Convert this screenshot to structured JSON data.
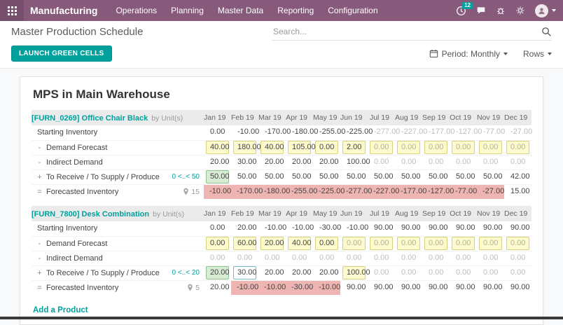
{
  "topbar": {
    "app": "Manufacturing",
    "menus": [
      "Operations",
      "Planning",
      "Master Data",
      "Reporting",
      "Configuration"
    ],
    "activity_count": "12"
  },
  "breadcrumb": {
    "title": "Master Production Schedule"
  },
  "search": {
    "placeholder": "Search..."
  },
  "controls": {
    "launch": "LAUNCH GREEN CELLS",
    "period": "Period: Monthly",
    "rows": "Rows"
  },
  "colors": {
    "brand": "#875A7B",
    "accent": "#00A09D",
    "cell_yellow": "#FDFACD",
    "cell_green": "#D8EBD3",
    "cell_red": "#EFB5B2"
  },
  "page": {
    "title": "MPS in Main Warehouse",
    "add_product": "Add a Product",
    "months": [
      "Jan 19",
      "Feb 19",
      "Mar 19",
      "Apr 19",
      "May 19",
      "Jun 19",
      "Jul 19",
      "Aug 19",
      "Sep 19",
      "Oct 19",
      "Nov 19",
      "Dec 19"
    ],
    "labels": {
      "starting": "Starting Inventory",
      "demand": "Demand Forecast",
      "indirect": "Indirect Demand",
      "supply": "To Receive / To Supply / Produce",
      "forecast": "Forecasted Inventory",
      "minus": "-",
      "plus": "+",
      "equals": "="
    },
    "products": [
      {
        "code": "[FURN_0269]",
        "name": "Office Chair Black",
        "by": "by",
        "uom": "Unit(s)",
        "supply_range": "0 <..< 50",
        "forecast_count": "15",
        "rows": {
          "starting": [
            {
              "v": "0.00",
              "k": "txt"
            },
            {
              "v": "-10.00",
              "k": "txt"
            },
            {
              "v": "-170.00",
              "k": "txt"
            },
            {
              "v": "-180.00",
              "k": "txt"
            },
            {
              "v": "-255.00",
              "k": "txt"
            },
            {
              "v": "-225.00",
              "k": "txt"
            },
            {
              "v": "-277.00",
              "k": "mut"
            },
            {
              "v": "-227.00",
              "k": "mut"
            },
            {
              "v": "-177.00",
              "k": "mut"
            },
            {
              "v": "-127.00",
              "k": "mut"
            },
            {
              "v": "-77.00",
              "k": "mut"
            },
            {
              "v": "-27.00",
              "k": "mut"
            }
          ],
          "demand": [
            {
              "v": "40.00",
              "k": "inp"
            },
            {
              "v": "180.00",
              "k": "inp"
            },
            {
              "v": "40.00",
              "k": "inp"
            },
            {
              "v": "105.00",
              "k": "inp"
            },
            {
              "v": "0.00",
              "k": "inp"
            },
            {
              "v": "2.00",
              "k": "inp"
            },
            {
              "v": "0.00",
              "k": "inpmut"
            },
            {
              "v": "0.00",
              "k": "inpmut"
            },
            {
              "v": "0.00",
              "k": "inpmut"
            },
            {
              "v": "0.00",
              "k": "inpmut"
            },
            {
              "v": "0.00",
              "k": "inpmut"
            },
            {
              "v": "0.00",
              "k": "inpmut"
            }
          ],
          "indirect": [
            {
              "v": "20.00",
              "k": "txt"
            },
            {
              "v": "30.00",
              "k": "txt"
            },
            {
              "v": "20.00",
              "k": "txt"
            },
            {
              "v": "20.00",
              "k": "txt"
            },
            {
              "v": "20.00",
              "k": "txt"
            },
            {
              "v": "100.00",
              "k": "txt"
            },
            {
              "v": "0.00",
              "k": "mut"
            },
            {
              "v": "0.00",
              "k": "mut"
            },
            {
              "v": "0.00",
              "k": "mut"
            },
            {
              "v": "0.00",
              "k": "mut"
            },
            {
              "v": "0.00",
              "k": "mut"
            },
            {
              "v": "0.00",
              "k": "mut"
            }
          ],
          "supply": [
            {
              "v": "50.00",
              "k": "grn"
            },
            {
              "v": "50.00",
              "k": "txt"
            },
            {
              "v": "50.00",
              "k": "txt"
            },
            {
              "v": "50.00",
              "k": "txt"
            },
            {
              "v": "50.00",
              "k": "txt"
            },
            {
              "v": "50.00",
              "k": "txt"
            },
            {
              "v": "50.00",
              "k": "txt"
            },
            {
              "v": "50.00",
              "k": "txt"
            },
            {
              "v": "50.00",
              "k": "txt"
            },
            {
              "v": "50.00",
              "k": "txt"
            },
            {
              "v": "50.00",
              "k": "txt"
            },
            {
              "v": "42.00",
              "k": "txt"
            }
          ],
          "forecast": [
            {
              "v": "-10.00",
              "k": "red"
            },
            {
              "v": "-170.00",
              "k": "red"
            },
            {
              "v": "-180.00",
              "k": "red"
            },
            {
              "v": "-255.00",
              "k": "red"
            },
            {
              "v": "-225.00",
              "k": "red"
            },
            {
              "v": "-277.00",
              "k": "red"
            },
            {
              "v": "-227.00",
              "k": "red"
            },
            {
              "v": "-177.00",
              "k": "red"
            },
            {
              "v": "-127.00",
              "k": "red"
            },
            {
              "v": "-77.00",
              "k": "red"
            },
            {
              "v": "-27.00",
              "k": "red"
            },
            {
              "v": "15.00",
              "k": "txt"
            }
          ]
        }
      },
      {
        "code": "[FURN_7800]",
        "name": "Desk Combination",
        "by": "by",
        "uom": "Unit(s)",
        "supply_range": "0 <..< 20",
        "forecast_count": "5",
        "rows": {
          "starting": [
            {
              "v": "0.00",
              "k": "txt"
            },
            {
              "v": "20.00",
              "k": "txt"
            },
            {
              "v": "-10.00",
              "k": "txt"
            },
            {
              "v": "-10.00",
              "k": "txt"
            },
            {
              "v": "-30.00",
              "k": "txt"
            },
            {
              "v": "-10.00",
              "k": "txt"
            },
            {
              "v": "90.00",
              "k": "txt"
            },
            {
              "v": "90.00",
              "k": "txt"
            },
            {
              "v": "90.00",
              "k": "txt"
            },
            {
              "v": "90.00",
              "k": "txt"
            },
            {
              "v": "90.00",
              "k": "txt"
            },
            {
              "v": "90.00",
              "k": "txt"
            }
          ],
          "demand": [
            {
              "v": "0.00",
              "k": "inp"
            },
            {
              "v": "60.00",
              "k": "inp"
            },
            {
              "v": "20.00",
              "k": "inp"
            },
            {
              "v": "40.00",
              "k": "inp"
            },
            {
              "v": "0.00",
              "k": "inp"
            },
            {
              "v": "0.00",
              "k": "inpmut"
            },
            {
              "v": "0.00",
              "k": "inpmut"
            },
            {
              "v": "0.00",
              "k": "inpmut"
            },
            {
              "v": "0.00",
              "k": "inpmut"
            },
            {
              "v": "0.00",
              "k": "inpmut"
            },
            {
              "v": "0.00",
              "k": "inpmut"
            },
            {
              "v": "0.00",
              "k": "inpmut"
            }
          ],
          "indirect": [
            {
              "v": "0.00",
              "k": "mut"
            },
            {
              "v": "0.00",
              "k": "mut"
            },
            {
              "v": "0.00",
              "k": "mut"
            },
            {
              "v": "0.00",
              "k": "mut"
            },
            {
              "v": "0.00",
              "k": "mut"
            },
            {
              "v": "0.00",
              "k": "mut"
            },
            {
              "v": "0.00",
              "k": "mut"
            },
            {
              "v": "0.00",
              "k": "mut"
            },
            {
              "v": "0.00",
              "k": "mut"
            },
            {
              "v": "0.00",
              "k": "mut"
            },
            {
              "v": "0.00",
              "k": "mut"
            },
            {
              "v": "0.00",
              "k": "mut"
            }
          ],
          "supply": [
            {
              "v": "20.00",
              "k": "grn"
            },
            {
              "v": "30.00",
              "k": "brd"
            },
            {
              "v": "20.00",
              "k": "txt"
            },
            {
              "v": "20.00",
              "k": "txt"
            },
            {
              "v": "20.00",
              "k": "txt"
            },
            {
              "v": "100.00",
              "k": "inp"
            },
            {
              "v": "0.00",
              "k": "mut"
            },
            {
              "v": "0.00",
              "k": "mut"
            },
            {
              "v": "0.00",
              "k": "mut"
            },
            {
              "v": "0.00",
              "k": "mut"
            },
            {
              "v": "0.00",
              "k": "mut"
            },
            {
              "v": "0.00",
              "k": "mut"
            }
          ],
          "forecast": [
            {
              "v": "20.00",
              "k": "txt"
            },
            {
              "v": "-10.00",
              "k": "red"
            },
            {
              "v": "-10.00",
              "k": "red"
            },
            {
              "v": "-30.00",
              "k": "red"
            },
            {
              "v": "-10.00",
              "k": "red"
            },
            {
              "v": "90.00",
              "k": "txt"
            },
            {
              "v": "90.00",
              "k": "txt"
            },
            {
              "v": "90.00",
              "k": "txt"
            },
            {
              "v": "90.00",
              "k": "txt"
            },
            {
              "v": "90.00",
              "k": "txt"
            },
            {
              "v": "90.00",
              "k": "txt"
            },
            {
              "v": "90.00",
              "k": "txt"
            }
          ]
        }
      }
    ]
  }
}
